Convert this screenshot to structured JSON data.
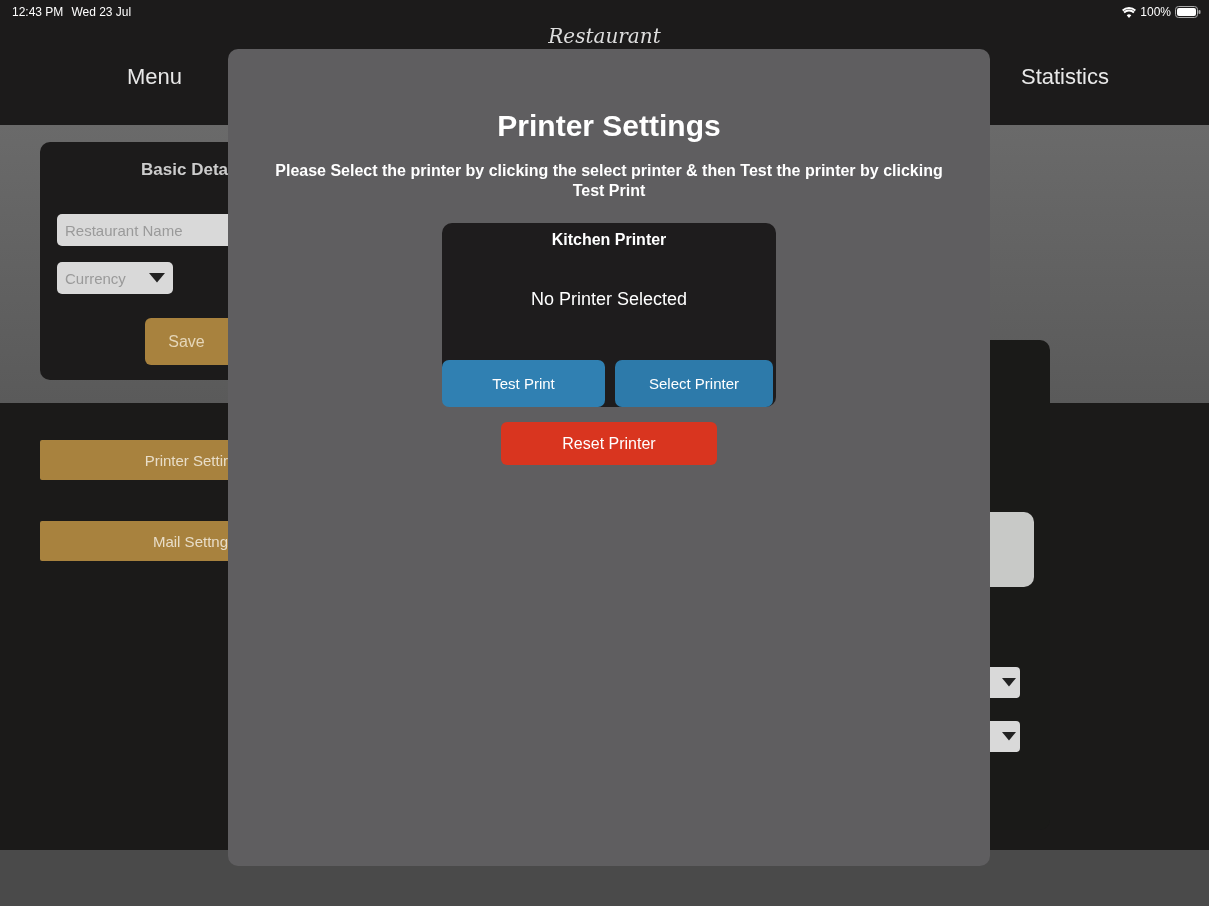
{
  "status_bar": {
    "time": "12:43 PM",
    "date": "Wed 23 Jul",
    "battery": "100%"
  },
  "header": {
    "logo": "Restaurant",
    "nav": [
      "Menu",
      "Statistics"
    ]
  },
  "basic_details": {
    "title": "Basic Deta",
    "name_field": {
      "placeholder": "Restaurant Name"
    },
    "currency_select": {
      "placeholder": "Currency"
    },
    "save_button": "Save"
  },
  "settings_buttons": [
    "Printer Settir",
    "Mail Settng"
  ],
  "modal": {
    "title": "Printer Settings",
    "instructions": "Please Select the printer by clicking the select printer & then Test the printer by clicking Test Print",
    "printer_card": {
      "title": "Kitchen Printer",
      "status": "No Printer Selected",
      "buttons": [
        {
          "label": "Test Print",
          "kind": "test"
        },
        {
          "label": "Select Printer",
          "kind": "select"
        }
      ]
    },
    "reset_button": "Reset Printer"
  }
}
